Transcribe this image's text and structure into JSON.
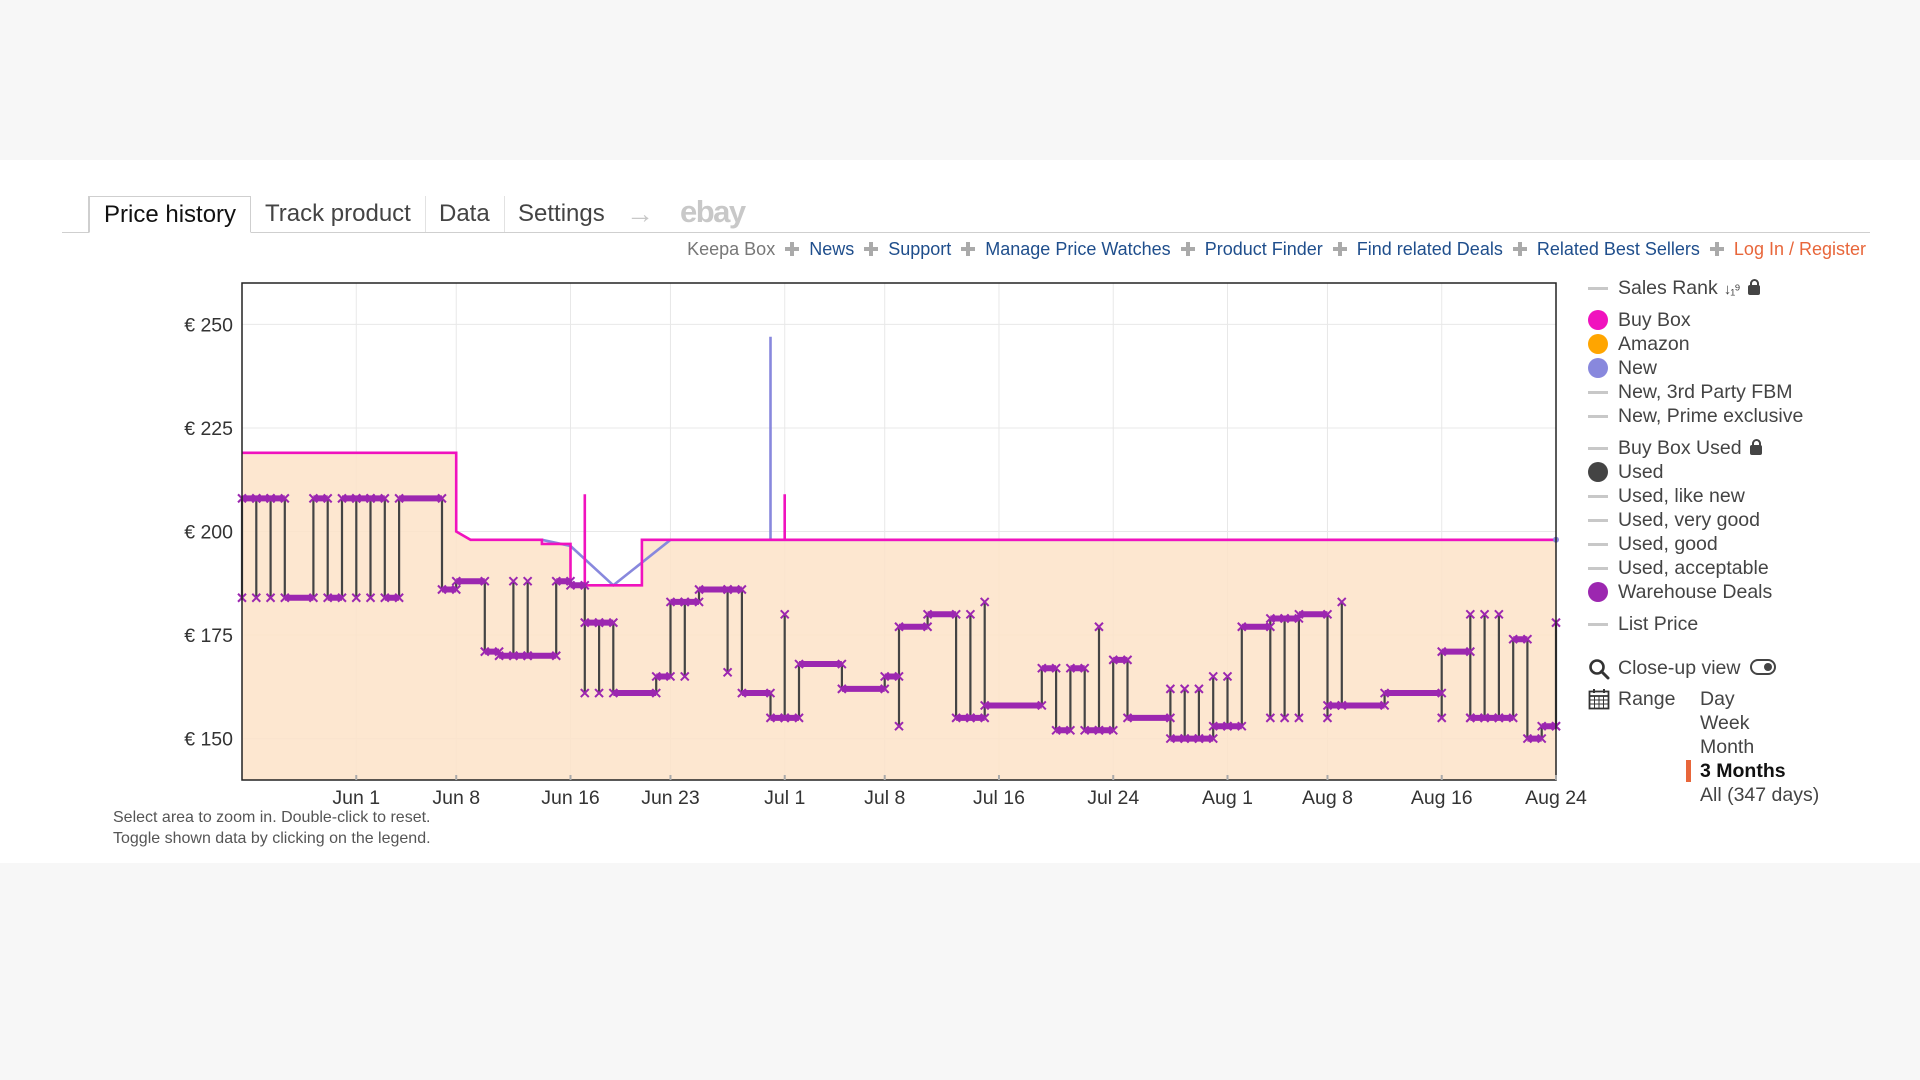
{
  "tabs": [
    {
      "label": "Price history",
      "active": true
    },
    {
      "label": "Track product",
      "active": false
    },
    {
      "label": "Data",
      "active": false
    },
    {
      "label": "Settings",
      "active": false
    }
  ],
  "tab_arrow": "→",
  "tab_ebay": "ebay",
  "links": {
    "keepa_box": "Keepa Box",
    "news": "News",
    "support": "Support",
    "manage": "Manage Price Watches",
    "finder": "Product Finder",
    "deals": "Find related Deals",
    "bestsellers": "Related Best Sellers",
    "login": "Log In / Register"
  },
  "hints": [
    "Select area to zoom in. Double-click to reset.",
    "Toggle shown data by clicking on the legend."
  ],
  "legend": {
    "sales_rank": "Sales Rank",
    "sort_icon": "↓₁⁹",
    "buy_box": "Buy Box",
    "amazon": "Amazon",
    "new": "New",
    "new_fbm": "New, 3rd Party FBM",
    "new_prime": "New, Prime exclusive",
    "buy_box_used": "Buy Box Used",
    "used": "Used",
    "used_like_new": "Used, like new",
    "used_very_good": "Used, very good",
    "used_good": "Used, good",
    "used_acceptable": "Used, acceptable",
    "warehouse": "Warehouse Deals",
    "list_price": "List Price",
    "closeup": "Close-up view",
    "range": "Range"
  },
  "range_options": [
    {
      "label": "Day",
      "active": false
    },
    {
      "label": "Week",
      "active": false
    },
    {
      "label": "Month",
      "active": false
    },
    {
      "label": "3 Months",
      "active": true
    },
    {
      "label": "All (347 days)",
      "active": false
    }
  ],
  "colors": {
    "buy_box": "#f012be",
    "amazon": "#ffa500",
    "new": "#8888dd",
    "used": "#444444",
    "warehouse": "#9c27b0",
    "area_fill": "#fde3c8",
    "accent": "#e8663a"
  },
  "chart_data": {
    "type": "line",
    "x_domain": [
      "2023-05-24",
      "2023-08-24"
    ],
    "ylim": [
      140,
      260
    ],
    "y_ticks": [
      {
        "value": 150,
        "label": "€ 150"
      },
      {
        "value": 175,
        "label": "€ 175"
      },
      {
        "value": 200,
        "label": "€ 200"
      },
      {
        "value": 225,
        "label": "€ 225"
      },
      {
        "value": 250,
        "label": "€ 250"
      }
    ],
    "x_ticks": [
      {
        "date": "2023-06-01",
        "label": "Jun 1"
      },
      {
        "date": "2023-06-08",
        "label": "Jun 8"
      },
      {
        "date": "2023-06-16",
        "label": "Jun 16"
      },
      {
        "date": "2023-06-23",
        "label": "Jun 23"
      },
      {
        "date": "2023-07-01",
        "label": "Jul 1"
      },
      {
        "date": "2023-07-08",
        "label": "Jul 8"
      },
      {
        "date": "2023-07-16",
        "label": "Jul 16"
      },
      {
        "date": "2023-07-24",
        "label": "Jul 24"
      },
      {
        "date": "2023-08-01",
        "label": "Aug 1"
      },
      {
        "date": "2023-08-08",
        "label": "Aug 8"
      },
      {
        "date": "2023-08-16",
        "label": "Aug 16"
      },
      {
        "date": "2023-08-24",
        "label": "Aug 24"
      }
    ],
    "grid": true,
    "series": [
      {
        "name": "New",
        "color": "#8888dd",
        "step": true,
        "points": [
          [
            "2023-06-14",
            198
          ],
          [
            "2023-06-16",
            196.5
          ],
          [
            "2023-06-19",
            187
          ],
          [
            "2023-06-23",
            198
          ],
          [
            "2023-06-30",
            198
          ],
          [
            "2023-06-30",
            247
          ],
          [
            "2023-06-30",
            198
          ],
          [
            "2023-08-24",
            198
          ]
        ]
      },
      {
        "name": "Buy Box",
        "color": "#f012be",
        "step": true,
        "area": true,
        "points": [
          [
            "2023-05-24",
            219
          ],
          [
            "2023-06-08",
            219
          ],
          [
            "2023-06-08",
            208.5
          ],
          [
            "2023-06-08",
            200
          ],
          [
            "2023-06-09",
            198
          ],
          [
            "2023-06-14",
            198
          ],
          [
            "2023-06-14",
            197
          ],
          [
            "2023-06-16",
            197
          ],
          [
            "2023-06-16",
            187
          ],
          [
            "2023-06-17",
            187
          ],
          [
            "2023-06-17",
            209
          ],
          [
            "2023-06-17",
            187
          ],
          [
            "2023-06-21",
            187
          ],
          [
            "2023-06-21",
            198
          ],
          [
            "2023-06-30",
            198
          ],
          [
            "2023-07-01",
            198
          ],
          [
            "2023-07-01",
            209
          ],
          [
            "2023-07-01",
            198
          ],
          [
            "2023-08-24",
            198
          ]
        ]
      },
      {
        "name": "Used",
        "color": "#444444",
        "step": true,
        "marker": "x",
        "points": [
          [
            "2023-05-24",
            184
          ],
          [
            "2023-05-24",
            208
          ],
          [
            "2023-05-25",
            208
          ],
          [
            "2023-05-25",
            184
          ],
          [
            "2023-05-25",
            208
          ],
          [
            "2023-05-26",
            208
          ],
          [
            "2023-05-26",
            184
          ],
          [
            "2023-05-26",
            208
          ],
          [
            "2023-05-27",
            208
          ],
          [
            "2023-05-27",
            184
          ],
          [
            "2023-05-29",
            184
          ],
          [
            "2023-05-29",
            208
          ],
          [
            "2023-05-30",
            208
          ],
          [
            "2023-05-30",
            184
          ],
          [
            "2023-05-31",
            184
          ],
          [
            "2023-05-31",
            208
          ],
          [
            "2023-06-01",
            208
          ],
          [
            "2023-06-01",
            184
          ],
          [
            "2023-06-01",
            208
          ],
          [
            "2023-06-02",
            208
          ],
          [
            "2023-06-02",
            184
          ],
          [
            "2023-06-02",
            208
          ],
          [
            "2023-06-03",
            208
          ],
          [
            "2023-06-03",
            184
          ],
          [
            "2023-06-04",
            184
          ],
          [
            "2023-06-04",
            208
          ],
          [
            "2023-06-07",
            208
          ],
          [
            "2023-06-07",
            186
          ],
          [
            "2023-06-08",
            186
          ],
          [
            "2023-06-08",
            188
          ],
          [
            "2023-06-10",
            188
          ],
          [
            "2023-06-10",
            171
          ],
          [
            "2023-06-11",
            171
          ],
          [
            "2023-06-11",
            170
          ],
          [
            "2023-06-12",
            170
          ],
          [
            "2023-06-12",
            188
          ],
          [
            "2023-06-12",
            170
          ],
          [
            "2023-06-13",
            170
          ],
          [
            "2023-06-13",
            188
          ],
          [
            "2023-06-13",
            170
          ],
          [
            "2023-06-15",
            170
          ],
          [
            "2023-06-15",
            188
          ],
          [
            "2023-06-16",
            188
          ],
          [
            "2023-06-16",
            187
          ],
          [
            "2023-06-17",
            187
          ],
          [
            "2023-06-17",
            161
          ],
          [
            "2023-06-17",
            178
          ],
          [
            "2023-06-18",
            178
          ],
          [
            "2023-06-18",
            161
          ],
          [
            "2023-06-18",
            178
          ],
          [
            "2023-06-19",
            178
          ],
          [
            "2023-06-19",
            161
          ],
          [
            "2023-06-22",
            161
          ],
          [
            "2023-06-22",
            165
          ],
          [
            "2023-06-23",
            165
          ],
          [
            "2023-06-23",
            183
          ],
          [
            "2023-06-24",
            183
          ],
          [
            "2023-06-24",
            165
          ],
          [
            "2023-06-24",
            183
          ],
          [
            "2023-06-25",
            183
          ],
          [
            "2023-06-25",
            186
          ],
          [
            "2023-06-27",
            186
          ],
          [
            "2023-06-27",
            166
          ],
          [
            "2023-06-27",
            186
          ],
          [
            "2023-06-28",
            186
          ],
          [
            "2023-06-28",
            161
          ],
          [
            "2023-06-30",
            161
          ],
          [
            "2023-06-30",
            155
          ],
          [
            "2023-07-01",
            155
          ],
          [
            "2023-07-01",
            180
          ],
          [
            "2023-07-01",
            155
          ],
          [
            "2023-07-02",
            155
          ],
          [
            "2023-07-02",
            168
          ],
          [
            "2023-07-05",
            168
          ],
          [
            "2023-07-05",
            162
          ],
          [
            "2023-07-08",
            162
          ],
          [
            "2023-07-08",
            165
          ],
          [
            "2023-07-09",
            165
          ],
          [
            "2023-07-09",
            153
          ],
          [
            "2023-07-09",
            177
          ],
          [
            "2023-07-11",
            177
          ],
          [
            "2023-07-11",
            180
          ],
          [
            "2023-07-13",
            180
          ],
          [
            "2023-07-13",
            155
          ],
          [
            "2023-07-14",
            155
          ],
          [
            "2023-07-14",
            180
          ],
          [
            "2023-07-14",
            155
          ],
          [
            "2023-07-15",
            155
          ],
          [
            "2023-07-15",
            183
          ],
          [
            "2023-07-15",
            158
          ],
          [
            "2023-07-19",
            158
          ],
          [
            "2023-07-19",
            167
          ],
          [
            "2023-07-20",
            167
          ],
          [
            "2023-07-20",
            152
          ],
          [
            "2023-07-21",
            152
          ],
          [
            "2023-07-21",
            167
          ],
          [
            "2023-07-22",
            167
          ],
          [
            "2023-07-22",
            152
          ],
          [
            "2023-07-23",
            152
          ],
          [
            "2023-07-23",
            177
          ],
          [
            "2023-07-23",
            152
          ],
          [
            "2023-07-24",
            152
          ],
          [
            "2023-07-24",
            169
          ],
          [
            "2023-07-25",
            169
          ],
          [
            "2023-07-25",
            155
          ],
          [
            "2023-07-28",
            155
          ],
          [
            "2023-07-28",
            162
          ],
          [
            "2023-07-28",
            150
          ],
          [
            "2023-07-29",
            150
          ],
          [
            "2023-07-29",
            162
          ],
          [
            "2023-07-29",
            150
          ],
          [
            "2023-07-30",
            150
          ],
          [
            "2023-07-30",
            162
          ],
          [
            "2023-07-30",
            150
          ],
          [
            "2023-07-31",
            150
          ],
          [
            "2023-07-31",
            165
          ],
          [
            "2023-07-31",
            153
          ],
          [
            "2023-08-01",
            153
          ],
          [
            "2023-08-01",
            165
          ],
          [
            "2023-08-01",
            153
          ],
          [
            "2023-08-02",
            153
          ],
          [
            "2023-08-02",
            177
          ],
          [
            "2023-08-04",
            177
          ],
          [
            "2023-08-04",
            155
          ],
          [
            "2023-08-04",
            179
          ],
          [
            "2023-08-05",
            179
          ],
          [
            "2023-08-05",
            155
          ],
          [
            "2023-08-05",
            179
          ],
          [
            "2023-08-06",
            179
          ],
          [
            "2023-08-06",
            155
          ],
          [
            "2023-08-06",
            180
          ],
          [
            "2023-08-08",
            180
          ],
          [
            "2023-08-08",
            155
          ],
          [
            "2023-08-08",
            158
          ],
          [
            "2023-08-09",
            158
          ],
          [
            "2023-08-09",
            183
          ],
          [
            "2023-08-09",
            158
          ],
          [
            "2023-08-12",
            158
          ],
          [
            "2023-08-12",
            161
          ],
          [
            "2023-08-16",
            161
          ],
          [
            "2023-08-16",
            155
          ],
          [
            "2023-08-16",
            171
          ],
          [
            "2023-08-18",
            171
          ],
          [
            "2023-08-18",
            155
          ],
          [
            "2023-08-18",
            180
          ],
          [
            "2023-08-18",
            155
          ],
          [
            "2023-08-19",
            155
          ],
          [
            "2023-08-19",
            180
          ],
          [
            "2023-08-19",
            155
          ],
          [
            "2023-08-20",
            155
          ],
          [
            "2023-08-20",
            180
          ],
          [
            "2023-08-20",
            155
          ],
          [
            "2023-08-21",
            155
          ],
          [
            "2023-08-21",
            174
          ],
          [
            "2023-08-22",
            174
          ],
          [
            "2023-08-22",
            150
          ],
          [
            "2023-08-23",
            150
          ],
          [
            "2023-08-23",
            153
          ],
          [
            "2023-08-24",
            153
          ],
          [
            "2023-08-24",
            178
          ],
          [
            "2023-08-24",
            153
          ]
        ]
      }
    ]
  }
}
